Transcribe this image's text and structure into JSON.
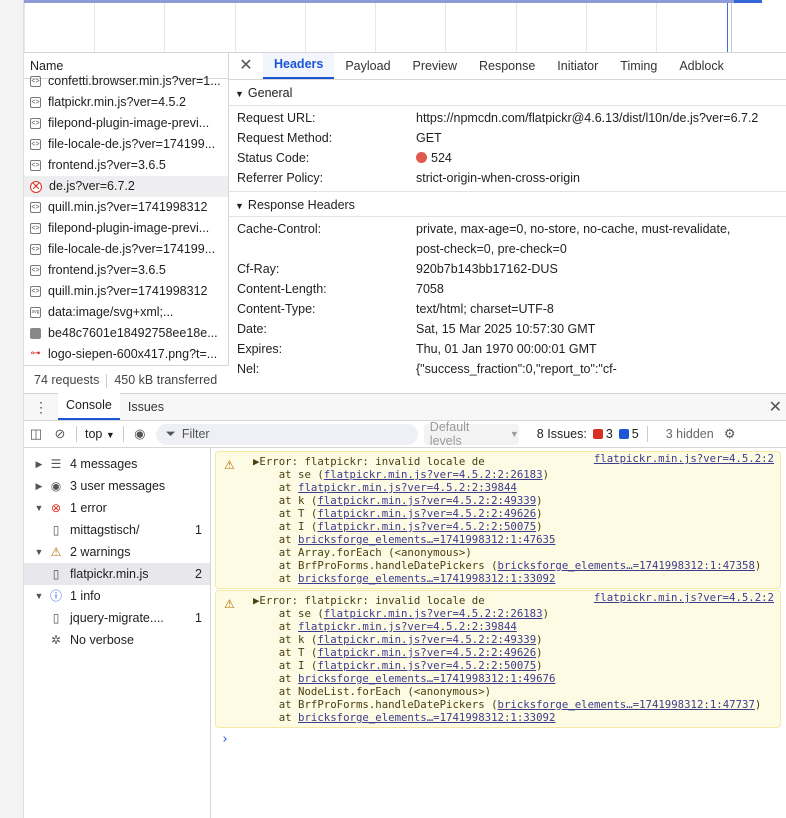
{
  "requests": {
    "column_header": "Name",
    "items": [
      {
        "icon": "script-icon",
        "name": "confetti.browser.min.js?ver=1...",
        "selected": false
      },
      {
        "icon": "script-icon",
        "name": "flatpickr.min.js?ver=4.5.2",
        "selected": false
      },
      {
        "icon": "script-icon",
        "name": "filepond-plugin-image-previ...",
        "selected": false
      },
      {
        "icon": "script-icon",
        "name": "file-locale-de.js?ver=174199...",
        "selected": false
      },
      {
        "icon": "script-icon",
        "name": "frontend.js?ver=3.6.5",
        "selected": false
      },
      {
        "icon": "error-icon",
        "name": "de.js?ver=6.7.2",
        "selected": true
      },
      {
        "icon": "script-icon",
        "name": "quill.min.js?ver=1741998312",
        "selected": false
      },
      {
        "icon": "script-icon",
        "name": "filepond-plugin-image-previ...",
        "selected": false
      },
      {
        "icon": "script-icon",
        "name": "file-locale-de.js?ver=174199...",
        "selected": false
      },
      {
        "icon": "script-icon",
        "name": "frontend.js?ver=3.6.5",
        "selected": false
      },
      {
        "icon": "script-icon",
        "name": "quill.min.js?ver=1741998312",
        "selected": false
      },
      {
        "icon": "svg-icon",
        "name": "data:image/svg+xml;...",
        "selected": false
      },
      {
        "icon": "image-icon",
        "name": "be48c7601e18492758ee18e...",
        "selected": false
      },
      {
        "icon": "image-link-icon",
        "name": "logo-siepen-600x417.png?t=...",
        "selected": false
      }
    ],
    "footer_requests": "74 requests",
    "footer_transferred": "450 kB transferred"
  },
  "detail": {
    "close": "✕",
    "tabs": [
      "Headers",
      "Payload",
      "Preview",
      "Response",
      "Initiator",
      "Timing",
      "Adblock"
    ],
    "active_tab": "Headers",
    "general_title": "General",
    "general": [
      {
        "k": "Request URL:",
        "v": "https://npmcdn.com/flatpickr@4.6.13/dist/l10n/de.js?ver=6.7.2"
      },
      {
        "k": "Request Method:",
        "v": "GET"
      },
      {
        "k": "Status Code:",
        "v": "524"
      },
      {
        "k": "Referrer Policy:",
        "v": "strict-origin-when-cross-origin"
      }
    ],
    "response_title": "Response Headers",
    "response": [
      {
        "k": "Cache-Control:",
        "v": "private, max-age=0, no-store, no-cache, must-revalidate,",
        "v2": "post-check=0, pre-check=0"
      },
      {
        "k": "Cf-Ray:",
        "v": "920b7b143bb17162-DUS"
      },
      {
        "k": "Content-Length:",
        "v": "7058"
      },
      {
        "k": "Content-Type:",
        "v": "text/html; charset=UTF-8"
      },
      {
        "k": "Date:",
        "v": "Sat, 15 Mar 2025 10:57:30 GMT"
      },
      {
        "k": "Expires:",
        "v": "Thu, 01 Jan 1970 00:00:01 GMT"
      },
      {
        "k": "Nel:",
        "v": "{\"success_fraction\":0,\"report_to\":\"cf-"
      }
    ],
    "status_color": "#e0594f"
  },
  "drawer": {
    "tabs": [
      "Console",
      "Issues"
    ],
    "active_tab": "Console",
    "close": "✕"
  },
  "console_toolbar": {
    "context": "top",
    "filter_placeholder": "Filter",
    "levels": "Default levels",
    "issues_label": "8 Issues:",
    "issues_errors": "3",
    "issues_info": "5",
    "hidden": "3 hidden"
  },
  "console_sidebar": [
    {
      "arrow": "▶",
      "icon": "list-icon",
      "label": "4 messages",
      "count": "",
      "indent": 0,
      "selected": false
    },
    {
      "arrow": "▶",
      "icon": "user-icon",
      "label": "3 user messages",
      "count": "",
      "indent": 0,
      "selected": false
    },
    {
      "arrow": "▼",
      "icon": "error-icon",
      "label": "1 error",
      "count": "",
      "indent": 0,
      "selected": false
    },
    {
      "arrow": "",
      "icon": "file-icon",
      "label": "mittagstisch/",
      "count": "1",
      "indent": 1,
      "selected": false
    },
    {
      "arrow": "▼",
      "icon": "warning-icon",
      "label": "2 warnings",
      "count": "",
      "indent": 0,
      "selected": false
    },
    {
      "arrow": "",
      "icon": "file-icon",
      "label": "flatpickr.min.js",
      "count": "2",
      "indent": 1,
      "selected": true
    },
    {
      "arrow": "▼",
      "icon": "info-icon",
      "label": "1 info",
      "count": "",
      "indent": 0,
      "selected": false
    },
    {
      "arrow": "",
      "icon": "file-icon",
      "label": "jquery-migrate....",
      "count": "1",
      "indent": 1,
      "selected": false
    },
    {
      "arrow": "",
      "icon": "bug-icon",
      "label": "No verbose",
      "count": "",
      "indent": 0,
      "selected": false
    }
  ],
  "console_messages": [
    {
      "source": "flatpickr.min.js?ver=4.5.2:2",
      "lines": [
        {
          "pre": "▶Error: flatpickr: invalid locale de",
          "link": "",
          "post": ""
        },
        {
          "pre": "    at se (",
          "link": "flatpickr.min.js?ver=4.5.2:2:26183",
          "post": ")"
        },
        {
          "pre": "    at ",
          "link": "flatpickr.min.js?ver=4.5.2:2:39844",
          "post": ""
        },
        {
          "pre": "    at k (",
          "link": "flatpickr.min.js?ver=4.5.2:2:49339",
          "post": ")"
        },
        {
          "pre": "    at T (",
          "link": "flatpickr.min.js?ver=4.5.2:2:49626",
          "post": ")"
        },
        {
          "pre": "    at I (",
          "link": "flatpickr.min.js?ver=4.5.2:2:50075",
          "post": ")"
        },
        {
          "pre": "    at ",
          "link": "bricksforge_elements…=1741998312:1:47635",
          "post": ""
        },
        {
          "pre": "    at Array.forEach (<anonymous>)",
          "link": "",
          "post": ""
        },
        {
          "pre": "    at BrfProForms.handleDatePickers (",
          "link": "bricksforge_elements…=1741998312:1:47358",
          "post": ")"
        },
        {
          "pre": "    at ",
          "link": "bricksforge_elements…=1741998312:1:33092",
          "post": ""
        }
      ]
    },
    {
      "source": "flatpickr.min.js?ver=4.5.2:2",
      "lines": [
        {
          "pre": "▶Error: flatpickr: invalid locale de",
          "link": "",
          "post": ""
        },
        {
          "pre": "    at se (",
          "link": "flatpickr.min.js?ver=4.5.2:2:26183",
          "post": ")"
        },
        {
          "pre": "    at ",
          "link": "flatpickr.min.js?ver=4.5.2:2:39844",
          "post": ""
        },
        {
          "pre": "    at k (",
          "link": "flatpickr.min.js?ver=4.5.2:2:49339",
          "post": ")"
        },
        {
          "pre": "    at T (",
          "link": "flatpickr.min.js?ver=4.5.2:2:49626",
          "post": ")"
        },
        {
          "pre": "    at I (",
          "link": "flatpickr.min.js?ver=4.5.2:2:50075",
          "post": ")"
        },
        {
          "pre": "    at ",
          "link": "bricksforge_elements…=1741998312:1:49676",
          "post": ""
        },
        {
          "pre": "    at NodeList.forEach (<anonymous>)",
          "link": "",
          "post": ""
        },
        {
          "pre": "    at BrfProForms.handleDatePickers (",
          "link": "bricksforge_elements…=1741998312:1:47737",
          "post": ")"
        },
        {
          "pre": "    at ",
          "link": "bricksforge_elements…=1741998312:1:33092",
          "post": ""
        }
      ]
    }
  ],
  "prompt": "›"
}
